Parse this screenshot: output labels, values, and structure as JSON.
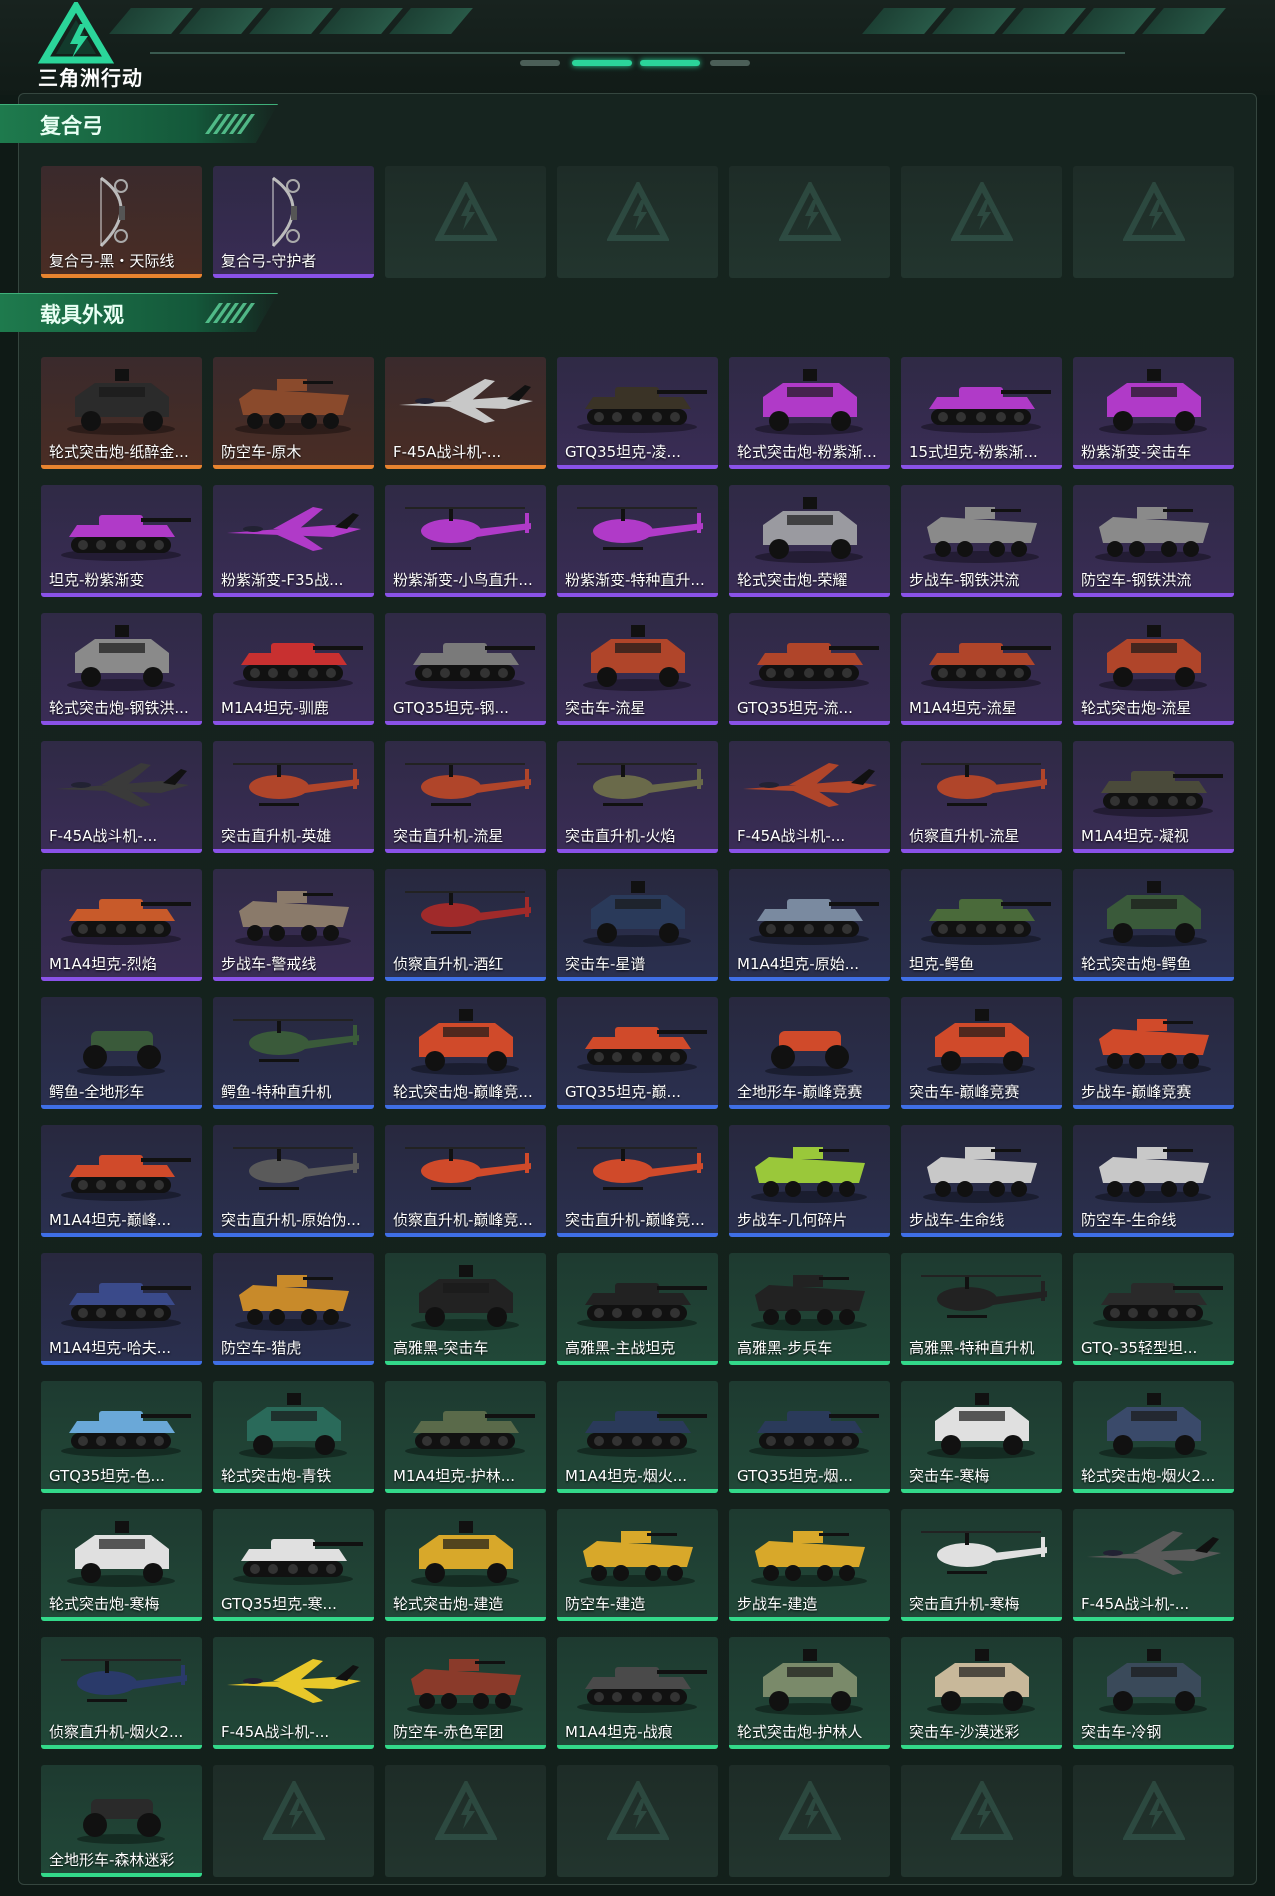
{
  "header": {
    "logo_text": "三角洲行动"
  },
  "colors": {
    "accent": "#2bd59a",
    "orange": "#e8842f",
    "purple": "#8a52e8",
    "blue": "#3f6fe6",
    "green": "#33d98a"
  },
  "sections": [
    {
      "title": "复合弓",
      "items": [
        {
          "name": "复合弓-黑・天际线",
          "rarity": "orange",
          "kind": "bow"
        },
        {
          "name": "复合弓-守护者",
          "rarity": "purple",
          "kind": "bow"
        },
        {
          "name": "",
          "rarity": "empty",
          "kind": "empty"
        },
        {
          "name": "",
          "rarity": "empty",
          "kind": "empty"
        },
        {
          "name": "",
          "rarity": "empty",
          "kind": "empty"
        },
        {
          "name": "",
          "rarity": "empty",
          "kind": "empty"
        },
        {
          "name": "",
          "rarity": "empty",
          "kind": "empty"
        }
      ]
    },
    {
      "title": "载具外观",
      "items": [
        {
          "name": "轮式突击炮-纸醉金...",
          "rarity": "orange",
          "kind": "truck",
          "color": "#2b2b2b"
        },
        {
          "name": "防空车-原木",
          "rarity": "orange",
          "kind": "apc",
          "color": "#8a4a2c"
        },
        {
          "name": "F-45A战斗机-...",
          "rarity": "orange",
          "kind": "jet",
          "color": "#c8c8c8"
        },
        {
          "name": "GTQ35坦克-凌...",
          "rarity": "purple",
          "kind": "tank",
          "color": "#3a3326"
        },
        {
          "name": "轮式突击炮-粉紫渐...",
          "rarity": "purple",
          "kind": "truck",
          "color": "#b03ac8"
        },
        {
          "name": "15式坦克-粉紫渐...",
          "rarity": "purple",
          "kind": "tank",
          "color": "#b03ac8"
        },
        {
          "name": "粉紫渐变-突击车",
          "rarity": "purple",
          "kind": "truck",
          "color": "#b03ac8"
        },
        {
          "name": "坦克-粉紫渐变",
          "rarity": "purple",
          "kind": "tank",
          "color": "#b03ac8"
        },
        {
          "name": "粉紫渐变-F35战...",
          "rarity": "purple",
          "kind": "jet",
          "color": "#b03ac8"
        },
        {
          "name": "粉紫渐变-小鸟直升...",
          "rarity": "purple",
          "kind": "heli",
          "color": "#b03ac8"
        },
        {
          "name": "粉紫渐变-特种直升...",
          "rarity": "purple",
          "kind": "heli",
          "color": "#b03ac8"
        },
        {
          "name": "轮式突击炮-荣耀",
          "rarity": "purple",
          "kind": "truck",
          "color": "#9a9aa0"
        },
        {
          "name": "步战车-钢铁洪流",
          "rarity": "purple",
          "kind": "apc",
          "color": "#8a8a8a"
        },
        {
          "name": "防空车-钢铁洪流",
          "rarity": "purple",
          "kind": "apc",
          "color": "#8a8a8a"
        },
        {
          "name": "轮式突击炮-钢铁洪...",
          "rarity": "purple",
          "kind": "truck",
          "color": "#8a8a8a"
        },
        {
          "name": "M1A4坦克-驯鹿",
          "rarity": "purple",
          "kind": "tank",
          "color": "#c83030"
        },
        {
          "name": "GTQ35坦克-钢...",
          "rarity": "purple",
          "kind": "tank",
          "color": "#7a7a7a"
        },
        {
          "name": "突击车-流星",
          "rarity": "purple",
          "kind": "truck",
          "color": "#b0452a"
        },
        {
          "name": "GTQ35坦克-流...",
          "rarity": "purple",
          "kind": "tank",
          "color": "#b0452a"
        },
        {
          "name": "M1A4坦克-流星",
          "rarity": "purple",
          "kind": "tank",
          "color": "#b0452a"
        },
        {
          "name": "轮式突击炮-流星",
          "rarity": "purple",
          "kind": "truck",
          "color": "#b0452a"
        },
        {
          "name": "F-45A战斗机-...",
          "rarity": "purple",
          "kind": "jet",
          "color": "#3a3a3a"
        },
        {
          "name": "突击直升机-英雄",
          "rarity": "purple",
          "kind": "heli",
          "color": "#b0452a"
        },
        {
          "name": "突击直升机-流星",
          "rarity": "purple",
          "kind": "heli",
          "color": "#b0452a"
        },
        {
          "name": "突击直升机-火焰",
          "rarity": "purple",
          "kind": "heli",
          "color": "#6a6a4a"
        },
        {
          "name": "F-45A战斗机-...",
          "rarity": "purple",
          "kind": "jet",
          "color": "#b0452a"
        },
        {
          "name": "侦察直升机-流星",
          "rarity": "purple",
          "kind": "heli",
          "color": "#b0452a"
        },
        {
          "name": "M1A4坦克-凝视",
          "rarity": "purple",
          "kind": "tank",
          "color": "#4a4a3a"
        },
        {
          "name": "M1A4坦克-烈焰",
          "rarity": "purple",
          "kind": "tank",
          "color": "#c85a2a"
        },
        {
          "name": "步战车-警戒线",
          "rarity": "purple",
          "kind": "apc",
          "color": "#8a7a6a"
        },
        {
          "name": "侦察直升机-酒红",
          "rarity": "blue",
          "kind": "heli",
          "color": "#a02a2a"
        },
        {
          "name": "突击车-星谱",
          "rarity": "blue",
          "kind": "truck",
          "color": "#2a3a5a"
        },
        {
          "name": "M1A4坦克-原始...",
          "rarity": "blue",
          "kind": "tank",
          "color": "#7a8aa0"
        },
        {
          "name": "坦克-鳄鱼",
          "rarity": "blue",
          "kind": "tank",
          "color": "#4a6a3a"
        },
        {
          "name": "轮式突击炮-鳄鱼",
          "rarity": "blue",
          "kind": "truck",
          "color": "#3a5a3a"
        },
        {
          "name": "鳄鱼-全地形车",
          "rarity": "blue",
          "kind": "atv",
          "color": "#3a5a3a"
        },
        {
          "name": "鳄鱼-特种直升机",
          "rarity": "blue",
          "kind": "heli",
          "color": "#3a5a3a"
        },
        {
          "name": "轮式突击炮-巅峰竞...",
          "rarity": "blue",
          "kind": "truck",
          "color": "#d04a2a"
        },
        {
          "name": "GTQ35坦克-巅...",
          "rarity": "blue",
          "kind": "tank",
          "color": "#d04a2a"
        },
        {
          "name": "全地形车-巅峰竞赛",
          "rarity": "blue",
          "kind": "atv",
          "color": "#d04a2a"
        },
        {
          "name": "突击车-巅峰竞赛",
          "rarity": "blue",
          "kind": "truck",
          "color": "#d04a2a"
        },
        {
          "name": "步战车-巅峰竞赛",
          "rarity": "blue",
          "kind": "apc",
          "color": "#d04a2a"
        },
        {
          "name": "M1A4坦克-巅峰...",
          "rarity": "blue",
          "kind": "tank",
          "color": "#d04a2a"
        },
        {
          "name": "突击直升机-原始伪...",
          "rarity": "blue",
          "kind": "heli",
          "color": "#5a5a5a"
        },
        {
          "name": "侦察直升机-巅峰竞...",
          "rarity": "blue",
          "kind": "heli",
          "color": "#d04a2a"
        },
        {
          "name": "突击直升机-巅峰竞...",
          "rarity": "blue",
          "kind": "heli",
          "color": "#d04a2a"
        },
        {
          "name": "步战车-几何碎片",
          "rarity": "blue",
          "kind": "apc",
          "color": "#9ac83a"
        },
        {
          "name": "步战车-生命线",
          "rarity": "blue",
          "kind": "apc",
          "color": "#c8c8c8"
        },
        {
          "name": "防空车-生命线",
          "rarity": "blue",
          "kind": "apc",
          "color": "#c8c8c8"
        },
        {
          "name": "M1A4坦克-哈夫...",
          "rarity": "blue",
          "kind": "tank",
          "color": "#3a4a8a"
        },
        {
          "name": "防空车-猎虎",
          "rarity": "blue",
          "kind": "apc",
          "color": "#c88a2a"
        },
        {
          "name": "高雅黑-突击车",
          "rarity": "green",
          "kind": "truck",
          "color": "#222222"
        },
        {
          "name": "高雅黑-主战坦克",
          "rarity": "green",
          "kind": "tank",
          "color": "#222222"
        },
        {
          "name": "高雅黑-步兵车",
          "rarity": "green",
          "kind": "apc",
          "color": "#222222"
        },
        {
          "name": "高雅黑-特种直升机",
          "rarity": "green",
          "kind": "heli",
          "color": "#222222"
        },
        {
          "name": "GTQ-35轻型坦...",
          "rarity": "green",
          "kind": "tank",
          "color": "#2a2a2a"
        },
        {
          "name": "GTQ35坦克-色...",
          "rarity": "green",
          "kind": "tank",
          "color": "#6aa8d8"
        },
        {
          "name": "轮式突击炮-青铁",
          "rarity": "green",
          "kind": "truck",
          "color": "#2a6a5a"
        },
        {
          "name": "M1A4坦克-护林...",
          "rarity": "green",
          "kind": "tank",
          "color": "#5a6a4a"
        },
        {
          "name": "M1A4坦克-烟火...",
          "rarity": "green",
          "kind": "tank",
          "color": "#2a3a5a"
        },
        {
          "name": "GTQ35坦克-烟...",
          "rarity": "green",
          "kind": "tank",
          "color": "#2a3a5a"
        },
        {
          "name": "突击车-寒梅",
          "rarity": "green",
          "kind": "truck",
          "color": "#e0e0e0"
        },
        {
          "name": "轮式突击炮-烟火2...",
          "rarity": "green",
          "kind": "truck",
          "color": "#3a4a6a"
        },
        {
          "name": "轮式突击炮-寒梅",
          "rarity": "green",
          "kind": "truck",
          "color": "#e0e0e0"
        },
        {
          "name": "GTQ35坦克-寒...",
          "rarity": "green",
          "kind": "tank",
          "color": "#e0e0e0"
        },
        {
          "name": "轮式突击炮-建造",
          "rarity": "green",
          "kind": "truck",
          "color": "#d8a82a"
        },
        {
          "name": "防空车-建造",
          "rarity": "green",
          "kind": "apc",
          "color": "#d8a82a"
        },
        {
          "name": "步战车-建造",
          "rarity": "green",
          "kind": "apc",
          "color": "#d8a82a"
        },
        {
          "name": "突击直升机-寒梅",
          "rarity": "green",
          "kind": "heli",
          "color": "#e0e0e0"
        },
        {
          "name": "F-45A战斗机-...",
          "rarity": "green",
          "kind": "jet",
          "color": "#5a5a5a"
        },
        {
          "name": "侦察直升机-烟火2...",
          "rarity": "green",
          "kind": "heli",
          "color": "#2a3a6a"
        },
        {
          "name": "F-45A战斗机-...",
          "rarity": "green",
          "kind": "jet",
          "color": "#e8c82a"
        },
        {
          "name": "防空车-赤色军团",
          "rarity": "green",
          "kind": "apc",
          "color": "#8a3a2a"
        },
        {
          "name": "M1A4坦克-战痕",
          "rarity": "green",
          "kind": "tank",
          "color": "#4a4a4a"
        },
        {
          "name": "轮式突击炮-护林人",
          "rarity": "green",
          "kind": "truck",
          "color": "#7a8a6a"
        },
        {
          "name": "突击车-沙漠迷彩",
          "rarity": "green",
          "kind": "truck",
          "color": "#c8b89a"
        },
        {
          "name": "突击车-冷钢",
          "rarity": "green",
          "kind": "truck",
          "color": "#3a4a5a"
        },
        {
          "name": "全地形车-森林迷彩",
          "rarity": "green",
          "kind": "atv",
          "color": "#2a2a2a"
        },
        {
          "name": "",
          "rarity": "empty",
          "kind": "empty"
        },
        {
          "name": "",
          "rarity": "empty",
          "kind": "empty"
        },
        {
          "name": "",
          "rarity": "empty",
          "kind": "empty"
        },
        {
          "name": "",
          "rarity": "empty",
          "kind": "empty"
        },
        {
          "name": "",
          "rarity": "empty",
          "kind": "empty"
        },
        {
          "name": "",
          "rarity": "empty",
          "kind": "empty"
        }
      ]
    }
  ]
}
